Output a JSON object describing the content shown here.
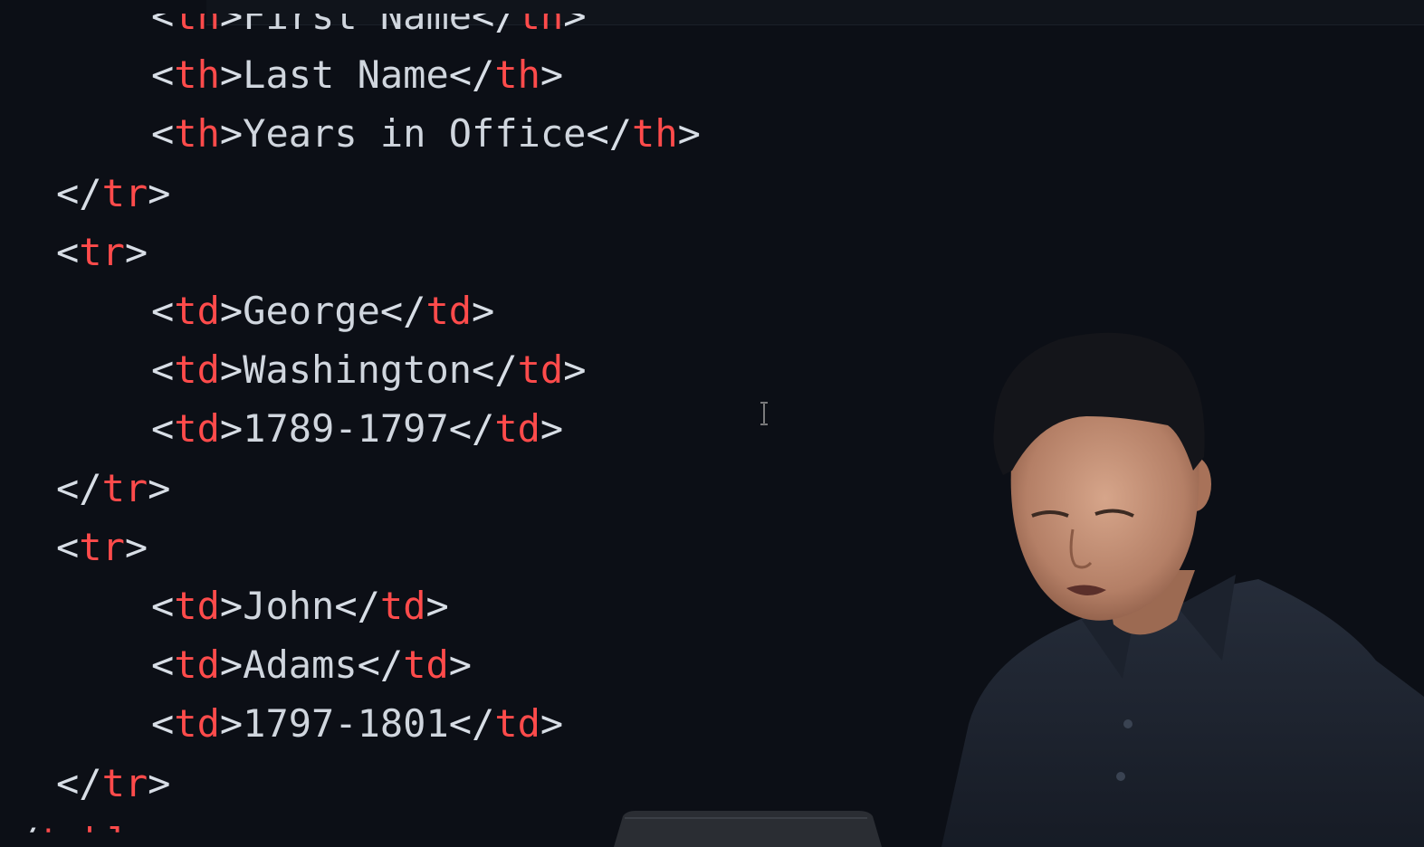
{
  "editor": {
    "lines": [
      {
        "indent": 1,
        "open": "th",
        "text": "First Name",
        "close": "th",
        "partial": "top"
      },
      {
        "indent": 1,
        "open": "th",
        "text": "Last Name",
        "close": "th"
      },
      {
        "indent": 1,
        "open": "th",
        "text": "Years in Office",
        "close": "th"
      },
      {
        "indent": 0,
        "close_only": "tr"
      },
      {
        "indent": 0,
        "open_only": "tr"
      },
      {
        "indent": 1,
        "open": "td",
        "text": "George",
        "close": "td"
      },
      {
        "indent": 1,
        "open": "td",
        "text": "Washington",
        "close": "td"
      },
      {
        "indent": 1,
        "open": "td",
        "text": "1789-1797",
        "close": "td"
      },
      {
        "indent": 0,
        "close_only": "tr"
      },
      {
        "indent": 0,
        "open_only": "tr"
      },
      {
        "indent": 1,
        "open": "td",
        "text": "John",
        "close": "td"
      },
      {
        "indent": 1,
        "open": "td",
        "text": "Adams",
        "close": "td"
      },
      {
        "indent": 1,
        "open": "td",
        "text": "1797-1801",
        "close": "td"
      },
      {
        "indent": 0,
        "close_only": "tr"
      },
      {
        "indent": -1,
        "close_only": "table",
        "partial": "bottom"
      }
    ]
  },
  "colors": {
    "background": "#0c0f16",
    "tag_name": "#ff4b4b",
    "punctuation": "#d8dee6",
    "content_text": "#d0d6de"
  },
  "icons": {
    "cursor": "text-cursor-ibeam-icon"
  }
}
